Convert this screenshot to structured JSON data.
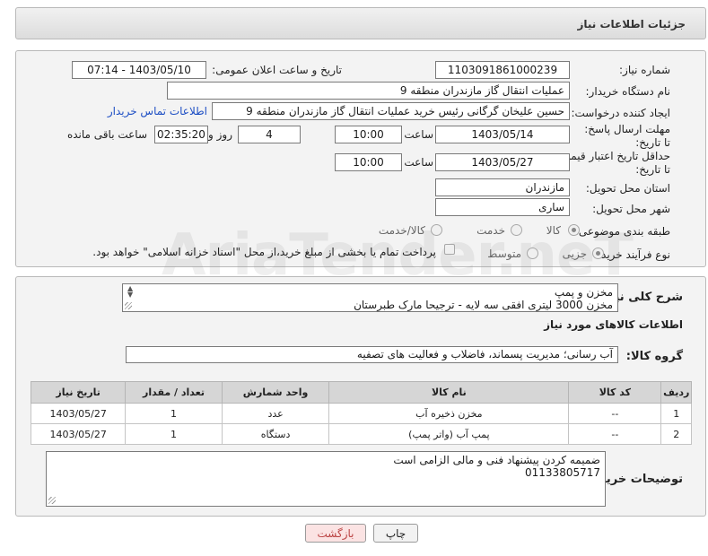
{
  "header": {
    "title": "جزئیات اطلاعات نیاز"
  },
  "watermark": "AriaTender.neT",
  "form": {
    "need_number_label": "شماره نیاز:",
    "need_number": "1103091861000239",
    "announce_label": "تاریخ و ساعت اعلان عمومی:",
    "announce_value": "1403/05/10 - 07:14",
    "buyer_org_label": "نام دستگاه خریدار:",
    "buyer_org": "عملیات انتقال گاز مازندران منطقه 9",
    "requester_label": "ایجاد کننده درخواست:",
    "requester": "حسین علیخان گرگانی رئیس خرید عملیات انتقال گاز مازندران منطقه 9",
    "contact_link": "اطلاعات تماس خریدار",
    "reply_deadline_label": "مهلت ارسال پاسخ: تا تاریخ:",
    "reply_date": "1403/05/14",
    "time_label": "ساعت",
    "reply_time": "10:00",
    "days_value": "4",
    "days_label": "روز و",
    "remaining_value": "02:35:20",
    "remaining_label": "ساعت باقی مانده",
    "validity_label": "حداقل تاریخ اعتبار قیمت: تا تاریخ:",
    "validity_date": "1403/05/27",
    "validity_time": "10:00",
    "province_label": "استان محل تحویل:",
    "province": "مازندران",
    "city_label": "شهر محل تحویل:",
    "city": "ساری",
    "category_label": "طبقه بندی موضوعی:",
    "category_options": [
      "کالا",
      "خدمت",
      "کالا/خدمت"
    ],
    "category_selected": "کالا",
    "process_label": "نوع فرآیند خرید :",
    "process_options": [
      "جزیی",
      "متوسط"
    ],
    "process_selected": "جزیی",
    "payment_note": "پرداخت تمام یا بخشی از مبلغ خرید،از محل \"اسناد خزانه اسلامی\" خواهد بود."
  },
  "description": {
    "label": "شرح کلی نیاز:",
    "line1": "مخزن و پمپ",
    "line2": "مخزن 3000 لیتری افقی سه لایه - ترجیحا مارک طبرستان"
  },
  "goods": {
    "section_title": "اطلاعات کالاهای مورد نیاز",
    "group_label": "گروه کالا:",
    "group_value": "آب رسانی؛ مدیریت پسماند، فاضلاب و فعالیت های تصفیه",
    "columns": [
      "ردیف",
      "کد کالا",
      "نام کالا",
      "واحد شمارش",
      "تعداد / مقدار",
      "تاریخ نیاز"
    ],
    "rows": [
      [
        "1",
        "--",
        "مخزن ذخیره آب",
        "عدد",
        "1",
        "1403/05/27"
      ],
      [
        "2",
        "--",
        "پمپ آب (واتر پمپ)",
        "دستگاه",
        "1",
        "1403/05/27"
      ]
    ]
  },
  "buyer_notes": {
    "label": "توضیحات خریدار:",
    "line1": "ضمیمه کردن پیشنهاد فنی و مالی الزامی است",
    "line2": "01133805717"
  },
  "buttons": {
    "print": "چاپ",
    "back": "بازگشت"
  },
  "colors": {
    "link": "#1e4fc4",
    "back_button_bg": "#fbe3e3",
    "header_bg": "#e6e6e6"
  }
}
